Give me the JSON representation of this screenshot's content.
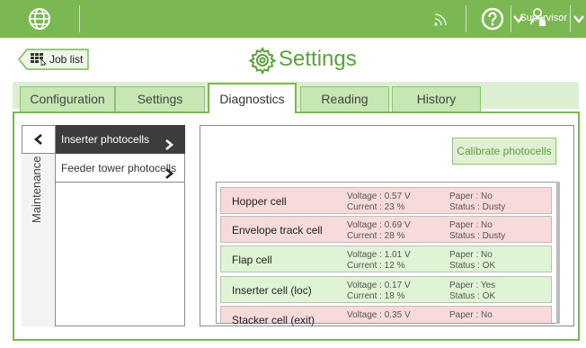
{
  "header": {
    "user_name": "Supervisor",
    "colors": {
      "bar": "#7ab851",
      "accent": "#5aa23a"
    },
    "icons": [
      "globe-icon",
      "signal-icon",
      "help-icon",
      "chevron-down-icon",
      "user-icon"
    ]
  },
  "nav": {
    "job_list_label": "Job list"
  },
  "page": {
    "title": "Settings"
  },
  "tabs": [
    {
      "label": "Configuration",
      "active": false
    },
    {
      "label": "Settings",
      "active": false
    },
    {
      "label": "Diagnostics",
      "active": true
    },
    {
      "label": "Reading",
      "active": false
    },
    {
      "label": "History",
      "active": false
    }
  ],
  "side_menu": {
    "section_label": "Maintenance",
    "items": [
      {
        "label": "Inserter photocells",
        "active": true
      },
      {
        "label": "Feeder tower photocells",
        "active": false
      }
    ]
  },
  "diagnostics": {
    "calibrate_label": "Calibrate photocells",
    "cells": [
      {
        "name": "Hopper cell",
        "voltage": "Voltage : 0.57 V",
        "current": "Current : 23 %",
        "paper": "Paper : No",
        "status": "Status : Dusty",
        "state": "red"
      },
      {
        "name": "Envelope track cell",
        "voltage": "Voltage : 0.69 V",
        "current": "Current : 28 %",
        "paper": "Paper : No",
        "status": "Status : Dusty",
        "state": "red"
      },
      {
        "name": "Flap cell",
        "voltage": "Voltage : 1.01 V",
        "current": "Current : 12 %",
        "paper": "Paper : No",
        "status": "Status : OK",
        "state": "green"
      },
      {
        "name": "Inserter cell (loc)",
        "voltage": "Voltage : 0.17 V",
        "current": "Current : 18 %",
        "paper": "Paper : Yes",
        "status": "Status : OK",
        "state": "green"
      },
      {
        "name": "Stacker cell (exit)",
        "voltage": "Voltage : 0.35 V",
        "current": "",
        "paper": "Paper : No",
        "status": "",
        "state": "red"
      }
    ]
  }
}
